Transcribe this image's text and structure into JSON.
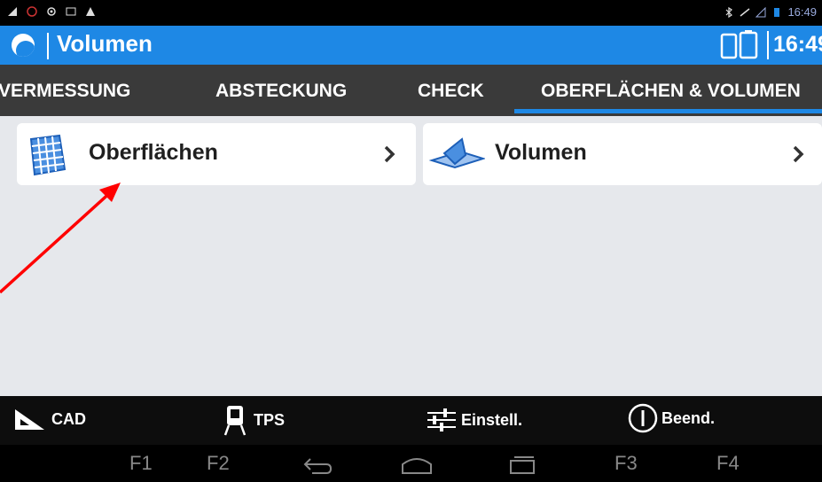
{
  "status_bar": {
    "time": "16:49"
  },
  "app_bar": {
    "title": "Volumen",
    "time": "16:49"
  },
  "tabs": [
    {
      "label": "VERMESSUNG"
    },
    {
      "label": "ABSTECKUNG"
    },
    {
      "label": "CHECK"
    },
    {
      "label": "OBERFLÄCHEN & VOLUMEN"
    }
  ],
  "active_tab": "OBERFLÄCHEN & VOLUMEN",
  "cards": [
    {
      "label": "Oberflächen",
      "icon": "grid-surface-icon"
    },
    {
      "label": "Volumen",
      "icon": "volume-prism-icon"
    }
  ],
  "bottom_bar": [
    {
      "label": "CAD",
      "icon": "triangle-ruler-icon"
    },
    {
      "label": "TPS",
      "icon": "total-station-icon"
    },
    {
      "label": "Einstell.",
      "icon": "sliders-icon"
    },
    {
      "label": "Beend.",
      "icon": "power-icon"
    }
  ],
  "nav_bar": {
    "f1": "F1",
    "f2": "F2",
    "f3": "F3",
    "f4": "F4"
  },
  "colors": {
    "accent": "#1e88e5",
    "tabbar": "#3a3a3a",
    "annotation_arrow": "#ff0000"
  }
}
